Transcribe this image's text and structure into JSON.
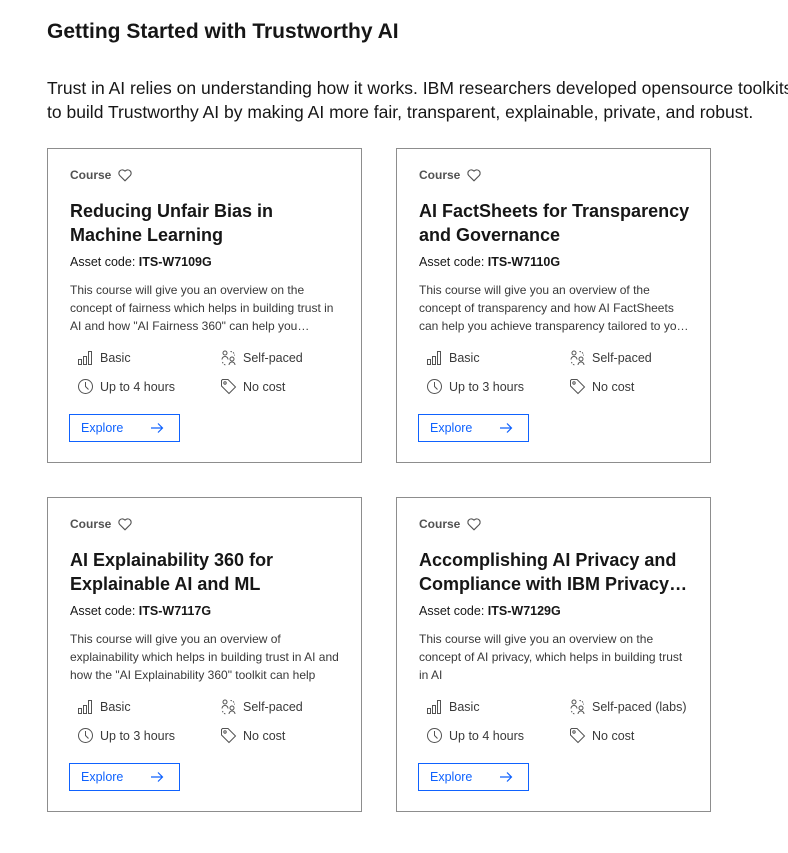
{
  "page": {
    "title": "Getting Started with Trustworthy AI",
    "intro": "Trust in AI relies on understanding how it works. IBM researchers developed opensource toolkits to build Trustworthy AI by making AI more fair, transparent, explainable, private, and robust."
  },
  "cards": [
    {
      "type": "Course",
      "title": "Reducing Unfair Bias in Machine Learning",
      "asset_label": "Asset code:",
      "asset_code": "ITS-W7109G",
      "description": "This course will give you an overview on the concept of fairness which helps in building trust in AI and how \"AI Fairness 360\" can help you mitigate bias",
      "level": "Basic",
      "pace": "Self-paced",
      "duration": "Up to 4 hours",
      "cost": "No cost",
      "button": "Explore"
    },
    {
      "type": "Course",
      "title": "AI FactSheets for Transparency and Governance",
      "asset_label": "Asset code:",
      "asset_code": "ITS-W7110G",
      "description": "This course will give you an overview of the concept of transparency and how AI FactSheets can help you achieve transparency tailored to your needs",
      "level": "Basic",
      "pace": "Self-paced",
      "duration": "Up to 3 hours",
      "cost": "No cost",
      "button": "Explore"
    },
    {
      "type": "Course",
      "title": "AI Explainability 360 for Explainable AI and ML",
      "asset_label": "Asset code:",
      "asset_code": "ITS-W7117G",
      "description": "This course will give you an overview of explainability which helps in building trust in AI and how the \"AI Explainability 360\" toolkit can help",
      "level": "Basic",
      "pace": "Self-paced",
      "duration": "Up to 3 hours",
      "cost": "No cost",
      "button": "Explore"
    },
    {
      "type": "Course",
      "title": "Accomplishing AI Privacy and Compliance with IBM Privacy Toolkit",
      "asset_label": "Asset code:",
      "asset_code": "ITS-W7129G",
      "description": "This course will give you an overview on the concept of AI privacy, which helps in building trust in AI",
      "level": "Basic",
      "pace": "Self-paced (labs)",
      "duration": "Up to 4 hours",
      "cost": "No cost",
      "button": "Explore"
    }
  ],
  "icons": {
    "favorite": "heart-icon",
    "level": "skill-level-icon",
    "pace": "self-paced-icon",
    "duration": "clock-icon",
    "cost": "price-tag-icon",
    "explore": "arrow-right-icon"
  },
  "colors": {
    "accent": "#0f62fe",
    "border": "#8d8d8d",
    "text": "#161616"
  }
}
